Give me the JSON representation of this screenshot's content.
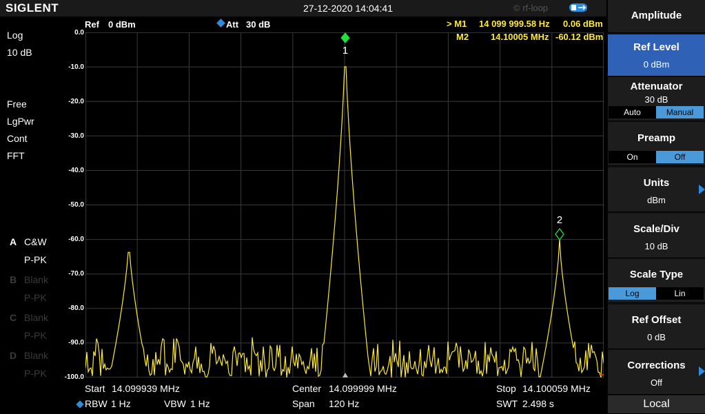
{
  "brand": "SIGLENT",
  "datetime": "27-12-2020 14:04:41",
  "watermark": "© rf-loop",
  "header": {
    "ref_label": "Ref",
    "ref_value": "0 dBm",
    "att_label": "Att",
    "att_value": "30 dB",
    "m1_label": "> M1",
    "m1_freq": "14 099 999.58 Hz",
    "m1_level": "0.06 dBm",
    "m2_label": "M2",
    "m2_freq": "14.10005 MHz",
    "m2_level": "-60.12 dBm"
  },
  "left_panel": {
    "scale_mode": "Log",
    "scale_div": "10 dB",
    "trig": "Free",
    "detector": "LgPwr",
    "sweep": "Cont",
    "mode": "FFT",
    "traces": [
      {
        "letter": "A",
        "type": "C&W",
        "det": "P-PK"
      },
      {
        "letter": "B",
        "type": "Blank",
        "det": "P-PK"
      },
      {
        "letter": "C",
        "type": "Blank",
        "det": "P-PK"
      },
      {
        "letter": "D",
        "type": "Blank",
        "det": "P-PK"
      }
    ]
  },
  "yticks": [
    "0.0",
    "-10.0",
    "-20.0",
    "-30.0",
    "-40.0",
    "-50.0",
    "-60.0",
    "-70.0",
    "-80.0",
    "-90.0",
    "-100.0"
  ],
  "markers": [
    {
      "label": "1"
    },
    {
      "label": "2"
    }
  ],
  "bottom": {
    "start_label": "Start",
    "start": "14.099939 MHz",
    "center_label": "Center",
    "center": "14.099999 MHz",
    "stop_label": "Stop",
    "stop": "14.100059 MHz",
    "rbw_label": "RBW",
    "rbw": "1 Hz",
    "vbw_label": "VBW",
    "vbw": "1 Hz",
    "span_label": "Span",
    "span": "120 Hz",
    "swt_label": "SWT",
    "swt": "2.498 s"
  },
  "softkeys": {
    "title": "Amplitude",
    "ref_level": {
      "label": "Ref Level",
      "value": "0 dBm"
    },
    "attenuator": {
      "label": "Attenuator",
      "value": "30 dB",
      "opt_a": "Auto",
      "opt_b": "Manual"
    },
    "preamp": {
      "label": "Preamp",
      "opt_a": "On",
      "opt_b": "Off"
    },
    "units": {
      "label": "Units",
      "value": "dBm"
    },
    "scale_div": {
      "label": "Scale/Div",
      "value": "10 dB"
    },
    "scale_type": {
      "label": "Scale Type",
      "opt_a": "Log",
      "opt_b": "Lin"
    },
    "ref_offset": {
      "label": "Ref Offset",
      "value": "0 dB"
    },
    "corrections": {
      "label": "Corrections",
      "value": "Off"
    },
    "local": "Local"
  },
  "colors": {
    "trace": "#ffea33",
    "marker": "#22e03a",
    "accent": "#2f62b6",
    "grid": "#3a3a3a"
  }
}
